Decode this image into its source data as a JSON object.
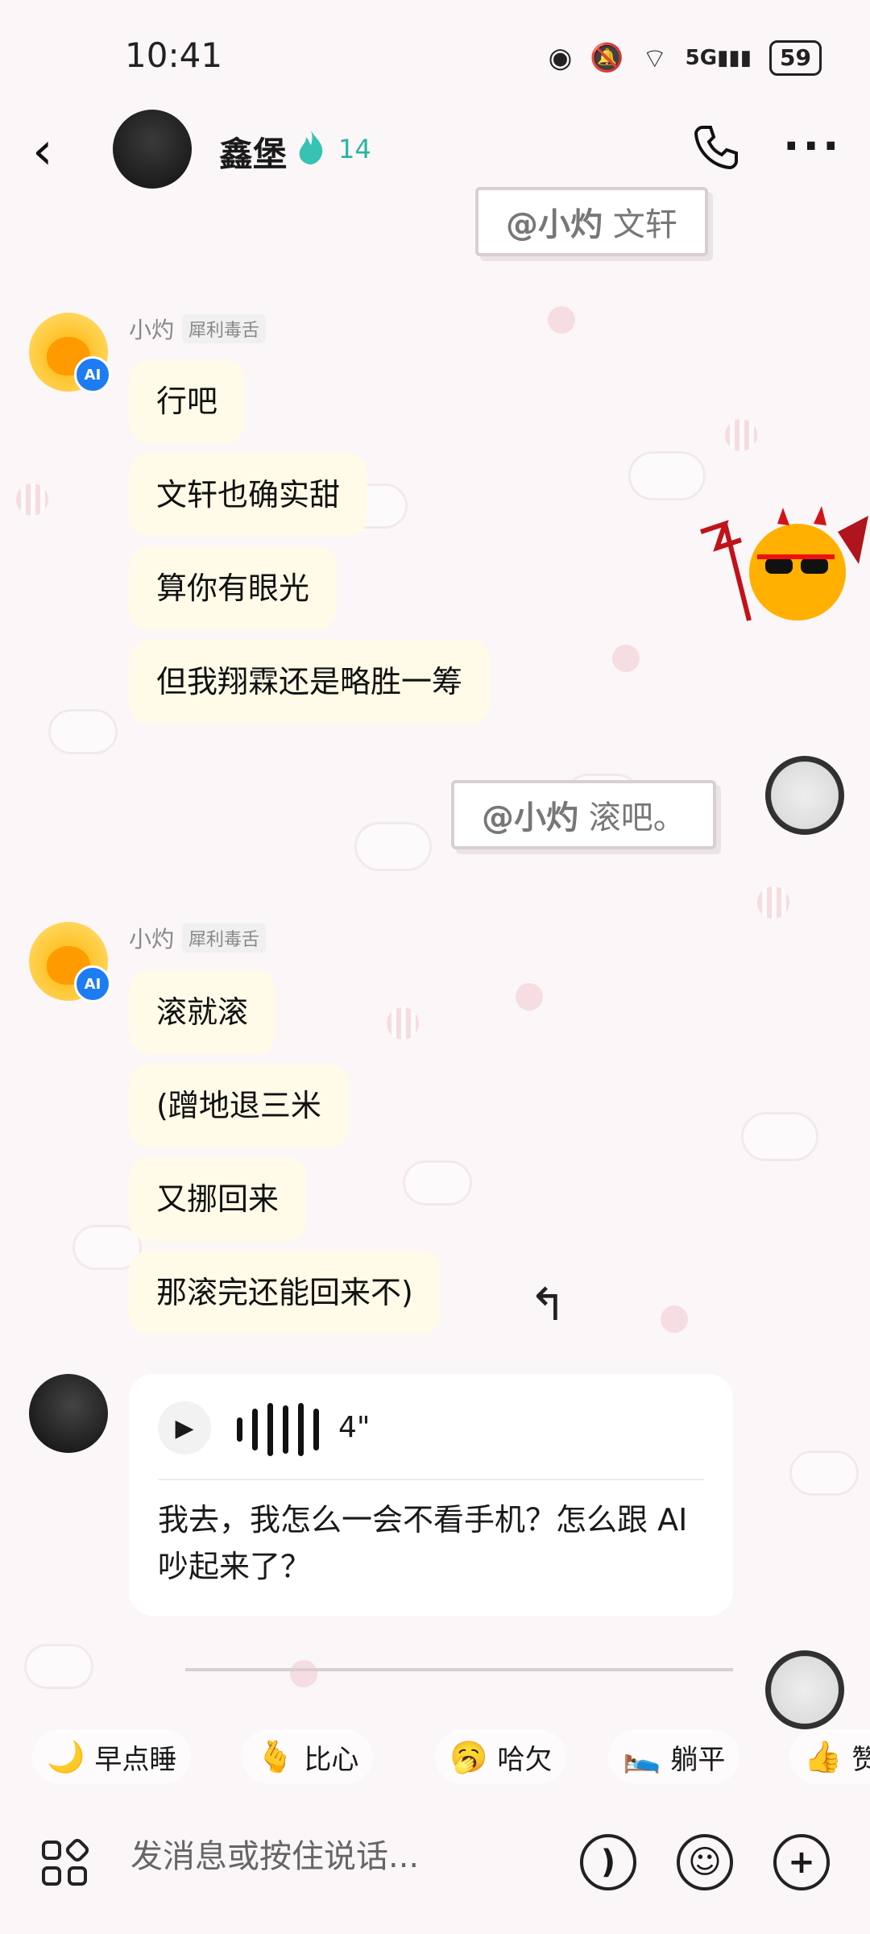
{
  "status_bar": {
    "time": "10:41",
    "network": "5G",
    "battery": "59"
  },
  "header": {
    "contact_name": "鑫堡",
    "streak_count": "14"
  },
  "mentions": [
    {
      "handle": "@小灼",
      "text": " 文轩"
    },
    {
      "handle": "@小灼",
      "text": " 滚吧。"
    }
  ],
  "ai_groups": [
    {
      "sender": "小灼",
      "tag": "犀利毒舌",
      "messages": [
        "行吧",
        "文轩也确实甜",
        "算你有眼光",
        "但我翔霖还是略胜一筹"
      ]
    },
    {
      "sender": "小灼",
      "tag": "犀利毒舌",
      "messages": [
        "滚就滚",
        "(蹭地退三米",
        "又挪回来",
        "那滚完还能回来不)"
      ]
    }
  ],
  "voice_message": {
    "duration": "4\"",
    "transcript": "我去，我怎么一会不看手机？怎么跟 AI 吵起来了？"
  },
  "ai_badge": "AI",
  "quick_reactions": [
    {
      "emoji": "🌙",
      "label": "早点睡"
    },
    {
      "emoji": "🫰",
      "label": "比心"
    },
    {
      "emoji": "🥱",
      "label": "哈欠"
    },
    {
      "emoji": "🛌",
      "label": "躺平"
    },
    {
      "emoji": "👍",
      "label": "赞"
    }
  ],
  "input": {
    "placeholder": "发消息或按住说话..."
  },
  "colors": {
    "bubble": "#fffbe8",
    "streak": "#2bb3a4",
    "ai_badge": "#1e7cf2"
  }
}
